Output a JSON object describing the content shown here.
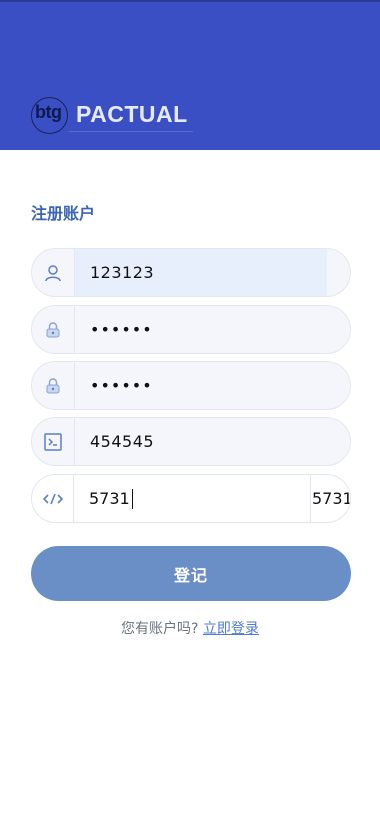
{
  "brand": {
    "logo_small": "btg",
    "logo_name": "PACTUAL",
    "header_color": "#3b4fc4"
  },
  "form": {
    "title": "注册账户",
    "username": {
      "value": "123123",
      "icon": "user-icon"
    },
    "password": {
      "value": "••••••",
      "icon": "lock-icon"
    },
    "confirm_password": {
      "value": "••••••",
      "icon": "lock-icon"
    },
    "invite_code": {
      "value": "454545",
      "icon": "terminal-icon"
    },
    "captcha": {
      "value": "5731",
      "code": "5731",
      "icon": "code-icon"
    },
    "submit_label": "登记",
    "submit_color": "#6a8fc6"
  },
  "footer": {
    "prompt": "您有账户吗?",
    "login_link": "立即登录"
  }
}
